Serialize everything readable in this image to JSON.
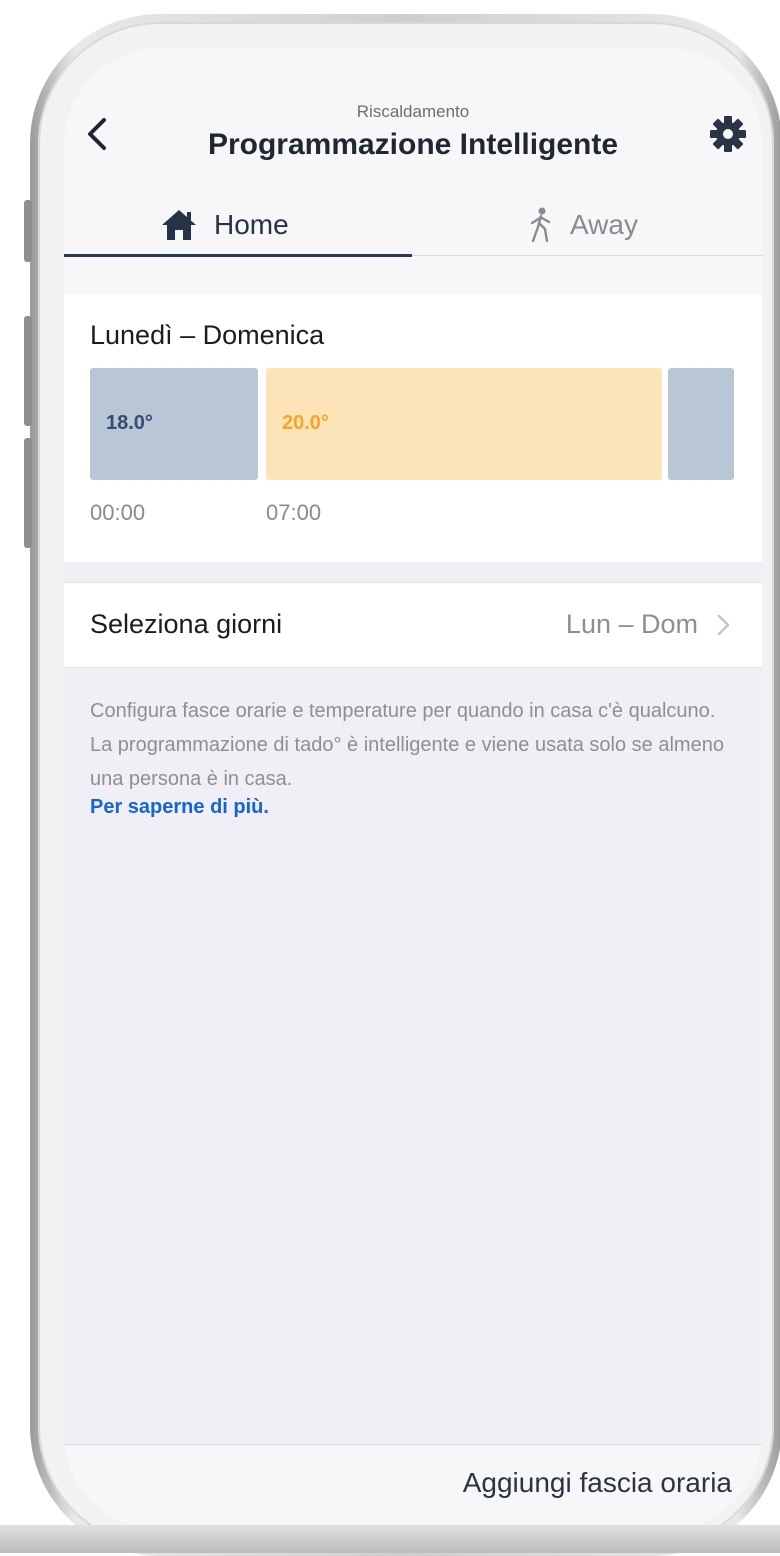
{
  "header": {
    "subtitle": "Riscaldamento",
    "title": "Programmazione Intelligente"
  },
  "tabs": [
    {
      "label": "Home",
      "icon": "home-icon",
      "active": true
    },
    {
      "label": "Away",
      "icon": "walking-person-icon",
      "active": false
    }
  ],
  "schedule": {
    "title": "Lunedì – Domenica",
    "blocks": [
      {
        "temp": "18.0°",
        "color": "#b8c6d6"
      },
      {
        "temp": "20.0°",
        "color": "#fde3b8"
      },
      {
        "temp": "",
        "color": "#b8c6d6"
      }
    ],
    "times": [
      "00:00",
      "07:00"
    ]
  },
  "select_days": {
    "label": "Seleziona giorni",
    "value": "Lun – Dom"
  },
  "description": "Configura fasce orarie e temperature per quando in casa c'è qualcuno. La programmazione di tado° è intelligente e viene usata solo se almeno una persona è in casa.",
  "learn_more": "Per saperne di più.",
  "footer": {
    "add_label": "Aggiungi fascia oraria"
  },
  "colors": {
    "accent_dark": "#2a3a53",
    "link": "#1565d8",
    "cool": "#b8c6d6",
    "warm": "#fde3b8"
  }
}
